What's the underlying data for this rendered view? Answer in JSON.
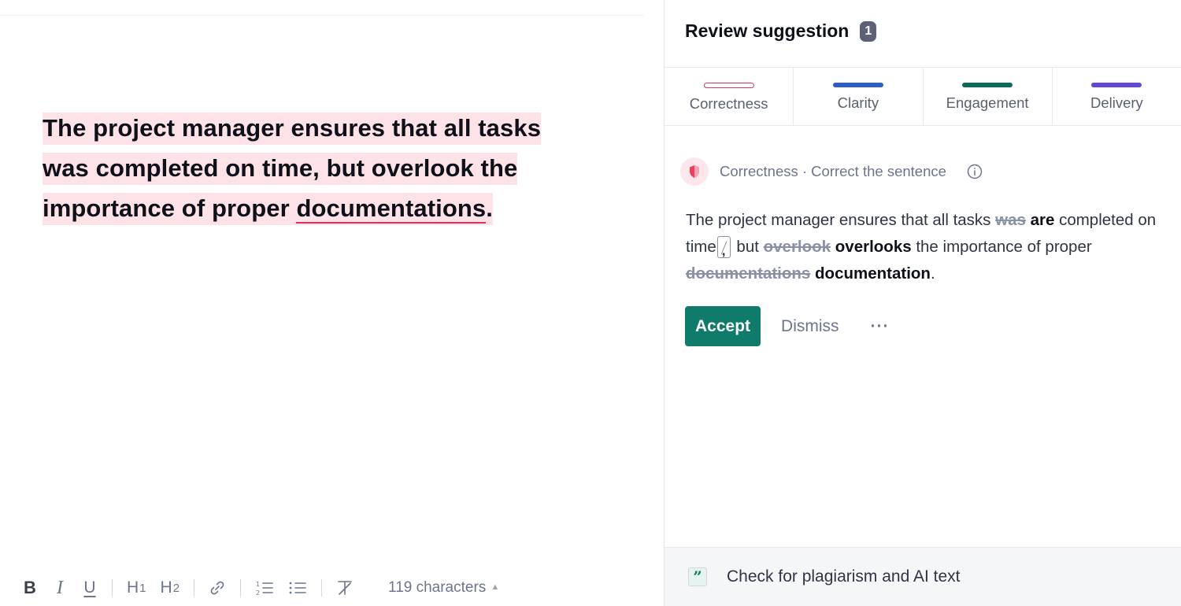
{
  "editor": {
    "document": {
      "segment_before": "The project manager ensures that all tasks was completed on time, but overlook the importance of proper ",
      "error_word": "documentations",
      "segment_after": "."
    },
    "toolbar": {
      "bold": "B",
      "italic": "I",
      "underline": "U",
      "h1": "H",
      "h1_sub": "1",
      "h2": "H",
      "h2_sub": "2",
      "character_count": "119 characters",
      "icons": [
        "link-icon",
        "numbered-list-icon",
        "bulleted-list-icon",
        "clear-format-icon",
        "caret-up-icon"
      ]
    }
  },
  "panel": {
    "title": "Review suggestion",
    "count": "1",
    "tabs": [
      {
        "label": "Correctness",
        "color": "#d8345f",
        "style": "outline"
      },
      {
        "label": "Clarity",
        "color": "#2d5dc9",
        "style": "solid"
      },
      {
        "label": "Engagement",
        "color": "#0b6b5a",
        "style": "solid"
      },
      {
        "label": "Delivery",
        "color": "#6446d8",
        "style": "solid"
      }
    ],
    "card": {
      "category": "Correctness · Correct the sentence",
      "suggestion": {
        "t1": "The project manager ensures that all tasks ",
        "del1": "was",
        "ins1": "are",
        "t2": "completed on time",
        "comma": ",",
        "t3": " but ",
        "del2": "overlook",
        "ins2": "overlooks",
        "t4": " the importance of proper ",
        "del3": "documentations",
        "ins3": "documentation",
        "t5": "."
      },
      "accept_label": "Accept",
      "dismiss_label": "Dismiss",
      "more_label": "···"
    },
    "plagiarism": {
      "label": "Check for plagiarism and AI text",
      "icon": "quote-icon",
      "icon_glyph": "”"
    }
  },
  "colors": {
    "accent": "#0f7c6b",
    "error": "#d8345f",
    "highlight": "#fde2e7"
  }
}
